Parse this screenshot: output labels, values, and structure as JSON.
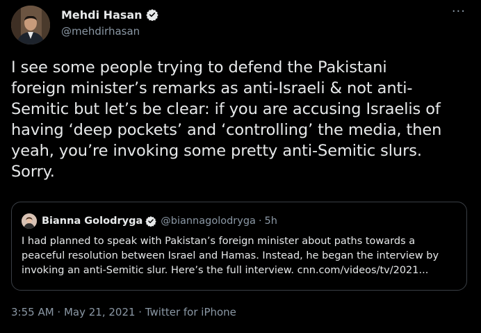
{
  "tweet": {
    "author": {
      "display_name": "Mehdi Hasan",
      "handle": "@mehdirhasan",
      "verified": true,
      "avatar_icon": "profile-photo"
    },
    "more_label": "···",
    "text": "I see some people trying to defend the Pakistani\nforeign minister’s remarks as anti-Israeli & not anti-\nSemitic but let’s be clear: if you are accusing Israelis of\nhaving ‘deep pockets’ and ‘controlling’ the media, then\nyeah, you’re invoking some pretty anti-Semitic slurs.\nSorry.",
    "quoted_tweet": {
      "display_name": "Bianna Golodryga",
      "handle": "@biannagolodryga",
      "separator": "·",
      "time_ago": "5h",
      "verified": true,
      "text": "I had planned to speak with Pakistan’s foreign minister about paths towards a\npeaceful resolution between Israel and Hamas. Instead, he began the interview by\ninvoking an anti-Semitic slur. Here’s the full interview. cnn.com/videos/tv/2021..."
    },
    "footer": "3:55 AM · May 21, 2021 · Twitter for iPhone"
  },
  "colors": {
    "background": "#000000",
    "text_primary": "#e7e9ea",
    "text_secondary": "#8b98a5",
    "border": "#3a3f45",
    "verified_badge": "#e7e9ea"
  }
}
